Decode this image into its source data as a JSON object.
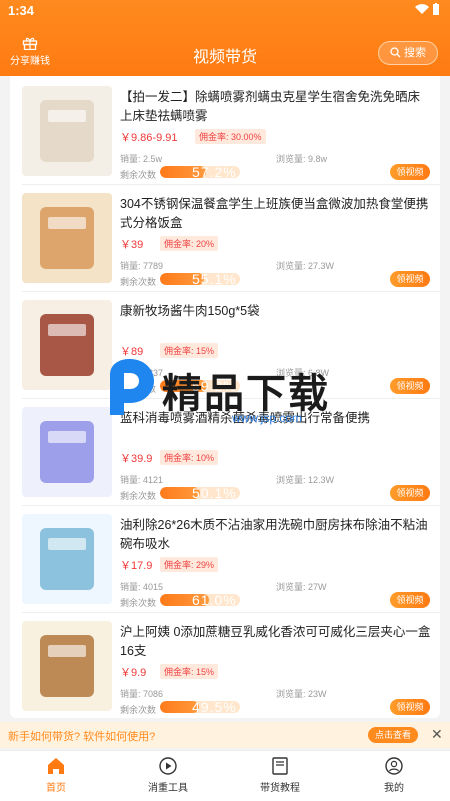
{
  "status": {
    "time": "1:34"
  },
  "header": {
    "share_label": "分享赚钱",
    "title": "视频带货",
    "search_label": "搜索"
  },
  "labels": {
    "commission_prefix": "佣金率: ",
    "sales_prefix": "销量: ",
    "views_prefix": "浏览量: ",
    "remaining_label": "剩余次数",
    "button": "领视频"
  },
  "products": [
    {
      "title": "【拍一发二】除螨喷雾剂螨虫克星学生宿舍免洗免晒床上床垫祛螨喷雾",
      "price": "￥9.86-9.91",
      "commission": "30.00%",
      "sales": "2.5w",
      "views": "9.8w",
      "remaining": "57.2%",
      "remaining_value": 57
    },
    {
      "title": "304不锈钢保温餐盒学生上班族便当盒微波加热食堂便携式分格饭盒",
      "price": "￥39",
      "commission": "20%",
      "sales": "7789",
      "views": "27.3W",
      "remaining": "55.1%",
      "remaining_value": 55
    },
    {
      "title": "康新牧场酱牛肉150g*5袋",
      "price": "￥89",
      "commission": "15%",
      "sales": "6837",
      "views": "6.8W",
      "remaining": "59.2%",
      "remaining_value": 59
    },
    {
      "title": "蓝科消毒喷雾酒精杀菌杀毒喷雾出行常备便携",
      "price": "￥39.9",
      "commission": "10%",
      "sales": "4121",
      "views": "12.3W",
      "remaining": "50.1%",
      "remaining_value": 50
    },
    {
      "title": "油利除26*26木质不沾油家用洗碗巾厨房抹布除油不粘油碗布吸水",
      "price": "￥17.9",
      "commission": "29%",
      "sales": "4015",
      "views": "27W",
      "remaining": "61.0%",
      "remaining_value": 61
    },
    {
      "title": "沪上阿姨 0添加蔗糖豆乳威化香浓可可威化三层夹心一盒16支",
      "price": "￥9.9",
      "commission": "15%",
      "sales": "7086",
      "views": "23W",
      "remaining": "49.5%",
      "remaining_value": 49
    }
  ],
  "tip": {
    "text": "新手如何带货? 软件如何使用?",
    "button": "点击查看"
  },
  "nav": [
    {
      "label": "首页",
      "icon": "home-icon"
    },
    {
      "label": "消重工具",
      "icon": "play-circle-icon"
    },
    {
      "label": "带货教程",
      "icon": "book-icon"
    },
    {
      "label": "我的",
      "icon": "user-icon"
    }
  ],
  "watermark": {
    "text": "精品下载",
    "url": "www.jsp.com"
  },
  "colors": {
    "accent": "#ff7b12",
    "price": "#f03838"
  }
}
